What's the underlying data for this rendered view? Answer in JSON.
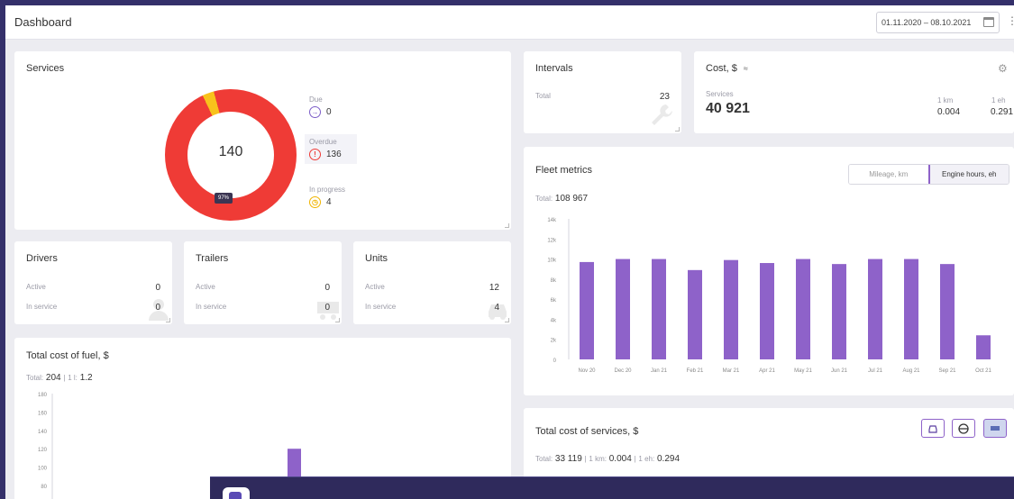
{
  "header": {
    "title": "Dashboard",
    "date_range": "01.11.2020 – 08.10.2021"
  },
  "services": {
    "title": "Services",
    "total": "140",
    "percent_badge": "97%",
    "due_label": "Due",
    "due_value": "0",
    "overdue_label": "Overdue",
    "overdue_value": "136",
    "in_progress_label": "In progress",
    "in_progress_value": "4"
  },
  "intervals": {
    "title": "Intervals",
    "total_label": "Total",
    "total_value": "23"
  },
  "cost": {
    "title": "Cost, $",
    "services_label": "Services",
    "services_value": "40 921",
    "per_km_label": "1 km",
    "per_km_value": "0.004",
    "per_eh_label": "1 eh",
    "per_eh_value": "0.291"
  },
  "drivers": {
    "title": "Drivers",
    "active_label": "Active",
    "active_value": "0",
    "in_service_label": "In service",
    "in_service_value": "0"
  },
  "trailers": {
    "title": "Trailers",
    "active_label": "Active",
    "active_value": "0",
    "in_service_label": "In service",
    "in_service_value": "0"
  },
  "units": {
    "title": "Units",
    "active_label": "Active",
    "active_value": "12",
    "in_service_label": "In service",
    "in_service_value": "4"
  },
  "fleet": {
    "title": "Fleet metrics",
    "total_label": "Total:",
    "total_value": "108 967",
    "mileage_tab": "Mileage, km",
    "engine_tab": "Engine hours, eh"
  },
  "fuel": {
    "title": "Total cost of fuel, $",
    "total_label": "Total:",
    "total_value": "204",
    "per_label": "1 l:",
    "per_value": "1.2"
  },
  "service_costs": {
    "title": "Total cost of services, $",
    "total_label": "Total:",
    "total_value": "33 119",
    "km_label": "1 km:",
    "km_value": "0.004",
    "eh_label": "1 eh:",
    "eh_value": "0.294"
  },
  "colors": {
    "accent": "#8e62c9",
    "donut_red": "#ef3b36",
    "donut_yellow": "#f8c21c"
  },
  "chart_data": [
    {
      "type": "bar",
      "categories": [
        "Nov 20",
        "Dec 20",
        "Jan 21",
        "Feb 21",
        "Mar 21",
        "Apr 21",
        "May 21",
        "Jun 21",
        "Jul 21",
        "Aug 21",
        "Sep 21",
        "Oct 21"
      ],
      "values": [
        9700,
        10000,
        10000,
        8900,
        9900,
        9600,
        10000,
        9500,
        10000,
        10000,
        9500,
        2400
      ],
      "yticks": [
        "0",
        "2k",
        "4k",
        "6k",
        "8k",
        "10k",
        "12k",
        "14k"
      ],
      "ylim": [
        0,
        14000
      ],
      "color": "#8e62c9"
    },
    {
      "type": "bar",
      "yticks": [
        "80",
        "100",
        "120",
        "140",
        "160",
        "180"
      ],
      "ylim": [
        80,
        180
      ],
      "values": [
        120
      ],
      "color": "#8e62c9"
    },
    {
      "type": "pie",
      "title": "Services",
      "categories": [
        "Overdue",
        "In progress",
        "Due"
      ],
      "values": [
        136,
        4,
        0
      ],
      "colors": [
        "#ef3b36",
        "#f8c21c",
        "#7b5cc7"
      ]
    }
  ]
}
